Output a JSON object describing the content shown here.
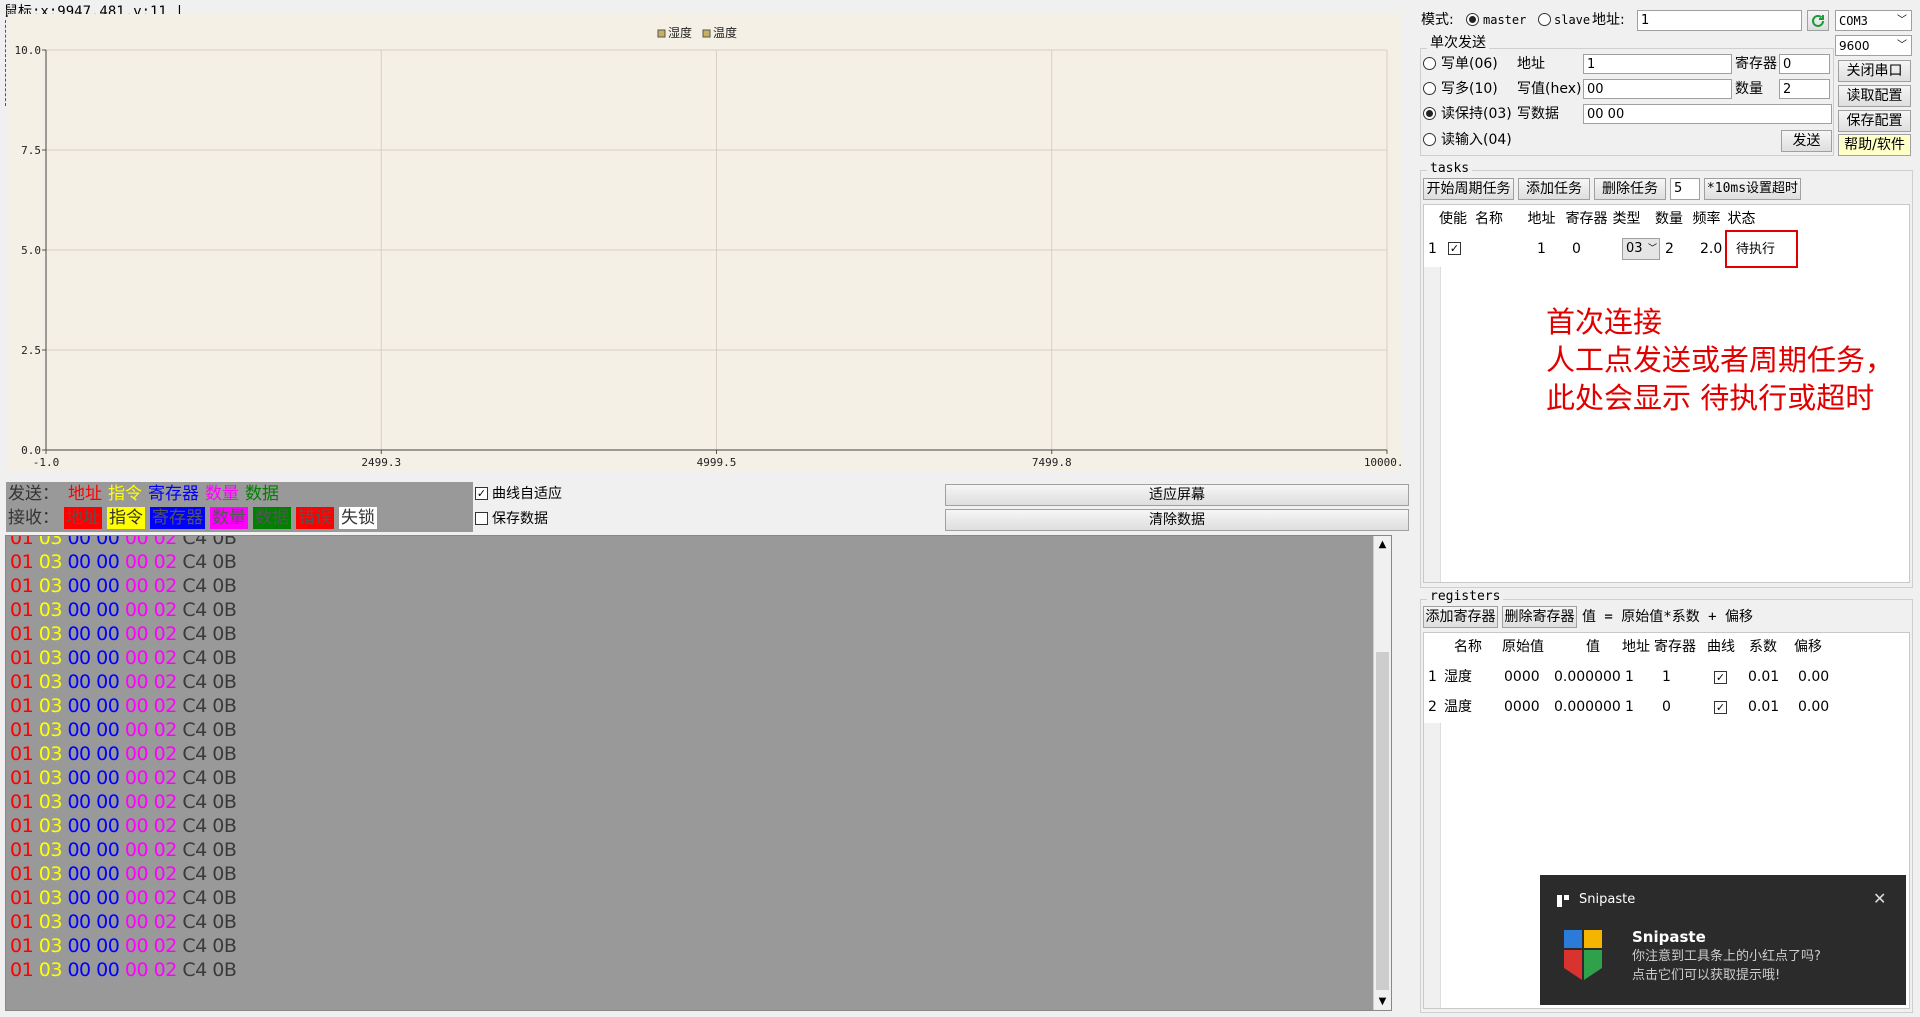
{
  "coord_readout": "鼠标:x:9947.481,y:11 |",
  "colors": {
    "addr": "#ff0000",
    "cmd": "#ffff00",
    "reg": "#0000ff",
    "count": "#ff00ff",
    "data": "#008000",
    "err": "#ff0000",
    "lock": "#ffffff",
    "chart_bg": "#f5f0e6",
    "log_bg": "#999999",
    "annotation": "#e00000"
  },
  "chart_data": {
    "type": "line",
    "series": [
      {
        "name": "湿度",
        "x": [],
        "values": []
      },
      {
        "name": "温度",
        "x": [],
        "values": []
      }
    ],
    "xlim": [
      -1.0,
      10000.0
    ],
    "ylim": [
      0.0,
      10.0
    ],
    "x_ticks": [
      "-1.0",
      "2499.3",
      "4999.5",
      "7499.8",
      "10000.0"
    ],
    "y_ticks": [
      "10.0",
      "7.5",
      "5.0",
      "2.5",
      "0.0"
    ],
    "legend_position": "top-center",
    "grid": true
  },
  "legend": {
    "send_label": "发送：",
    "send_items": [
      "地址",
      "指令",
      "寄存器",
      "数量",
      "数据"
    ],
    "recv_label": "接收：",
    "recv_items": [
      "地址",
      "指令",
      "寄存器",
      "数量",
      "数据",
      "错误",
      "失锁"
    ]
  },
  "options": {
    "auto_fit_label": "曲线自适应",
    "auto_fit_checked": true,
    "save_data_label": "保存数据",
    "save_data_checked": false,
    "fit_screen_button": "适应屏幕",
    "clear_data_button": "清除数据"
  },
  "log": {
    "frame": {
      "addr": "01",
      "cmd": "03",
      "reg": "00 00",
      "count": "00 02",
      "crc": "C4 0B"
    },
    "repeat": 19
  },
  "mode": {
    "label": "模式:",
    "master": "master",
    "slave": "slave",
    "selected": "master",
    "addr_label": "地址:",
    "addr_value": "1",
    "port_value": "COM3",
    "baud_value": "9600"
  },
  "single_send": {
    "title": "单次发送",
    "functions": [
      {
        "label": "写单(06)",
        "selected": false
      },
      {
        "label": "写多(10)",
        "selected": false
      },
      {
        "label": "读保持(03)",
        "selected": true
      },
      {
        "label": "读输入(04)",
        "selected": false
      }
    ],
    "addr_label": "地址",
    "addr_value": "1",
    "write_val_label": "写值(hex)",
    "write_val_value": "00",
    "write_data_label": "写数据",
    "write_data_value": "00 00",
    "reg_label": "寄存器",
    "reg_value": "0",
    "count_label": "数量",
    "count_value": "2",
    "send_button": "发送",
    "close_port_button": "关闭串口",
    "read_config_button": "读取配置",
    "save_config_button": "保存配置",
    "help_button": "帮助/软件"
  },
  "tasks": {
    "title": "tasks",
    "start_button": "开始周期任务",
    "add_button": "添加任务",
    "delete_button": "删除任务",
    "timeout_value": "5",
    "timeout_button": "*10ms设置超时",
    "headers": [
      "使能",
      "名称",
      "地址",
      "寄存器",
      "类型",
      "数量",
      "频率",
      "状态"
    ],
    "rows": [
      {
        "index": "1",
        "enabled": true,
        "name": "",
        "addr": "1",
        "reg": "0",
        "type": "03",
        "count": "2",
        "freq": "2.0",
        "status": "待执行"
      }
    ]
  },
  "annotation": {
    "lines": [
      "首次连接",
      "人工点发送或者周期任务，",
      "此处会显示 待执行或超时"
    ]
  },
  "registers": {
    "title": "registers",
    "add_button": "添加寄存器",
    "delete_button": "删除寄存器",
    "formula": "值 = 原始值*系数 + 偏移",
    "headers": [
      "名称",
      "原始值",
      "值",
      "地址",
      "寄存器",
      "曲线",
      "系数",
      "偏移"
    ],
    "rows": [
      {
        "index": "1",
        "name": "湿度",
        "raw": "0000",
        "value": "0.000000",
        "addr": "1",
        "reg": "1",
        "curve": true,
        "coef": "0.01",
        "offset": "0.00"
      },
      {
        "index": "2",
        "name": "温度",
        "raw": "0000",
        "value": "0.000000",
        "addr": "1",
        "reg": "0",
        "curve": true,
        "coef": "0.01",
        "offset": "0.00"
      }
    ]
  },
  "toast": {
    "app": "Snipaste",
    "title": "Snipaste",
    "lines": [
      "你注意到工具条上的小红点了吗?",
      "点击它们可以获取提示哦!"
    ]
  }
}
